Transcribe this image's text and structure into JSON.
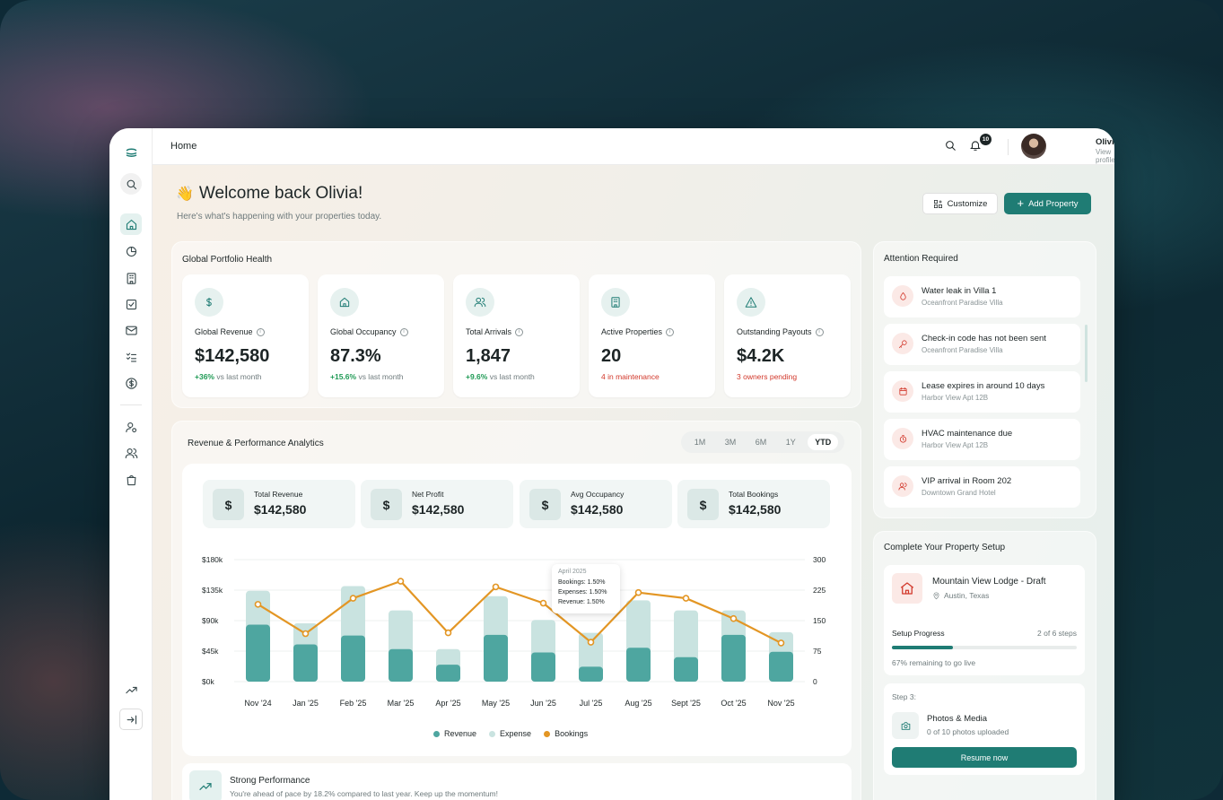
{
  "topbar": {
    "breadcrumb": "Home",
    "notification_count": "10",
    "user_name": "Olivia",
    "user_sub": "View profile"
  },
  "header": {
    "wave_emoji": "👋",
    "title": "Welcome back Olivia!",
    "subtitle": "Here's what's happening with your properties today.",
    "customize_label": "Customize",
    "add_property_label": "Add Property"
  },
  "portfolio": {
    "title": "Global Portfolio Health",
    "cards": [
      {
        "icon": "dollar-icon",
        "label": "Global Revenue",
        "value": "$142,580",
        "delta": "+36%",
        "note": " vs last month"
      },
      {
        "icon": "home-icon",
        "label": "Global Occupancy",
        "value": "87.3%",
        "delta": "+15.6%",
        "note": " vs last month"
      },
      {
        "icon": "users-icon",
        "label": "Total Arrivals",
        "value": "1,847",
        "delta": "+9.6%",
        "note": " vs last month"
      },
      {
        "icon": "building-icon",
        "label": "Active Properties",
        "value": "20",
        "alert": "4 in maintenance"
      },
      {
        "icon": "warning-icon",
        "label": "Outstanding Payouts",
        "value": "$4.2K",
        "alert": "3 owners pending"
      }
    ]
  },
  "analytics": {
    "title": "Revenue & Performance Analytics",
    "ranges": [
      "1M",
      "3M",
      "6M",
      "1Y",
      "YTD"
    ],
    "active_range": "YTD",
    "stats": [
      {
        "label": "Total Revenue",
        "value": "$142,580"
      },
      {
        "label": "Net Profit",
        "value": "$142,580"
      },
      {
        "label": "Avg Occupancy",
        "value": "$142,580"
      },
      {
        "label": "Total Bookings",
        "value": "$142,580"
      }
    ],
    "stat_icon_glyph": "$",
    "tooltip": {
      "title": "April 2025",
      "bookings": "Bookings: 1.50%",
      "expenses": "Expenses: 1.50%",
      "revenue": "Revenue: 1.50%"
    },
    "legend": {
      "revenue": "Revenue",
      "expense": "Expense",
      "bookings": "Bookings"
    }
  },
  "chart_data": {
    "type": "bar",
    "categories": [
      "Nov '24",
      "Jan '25",
      "Feb '25",
      "Mar '25",
      "Apr '25",
      "May '25",
      "Jun '25",
      "Jul '25",
      "Aug '25",
      "Sept '25",
      "Oct '25",
      "Nov '25"
    ],
    "left_axis": {
      "ticks": [
        "$0k",
        "$45k",
        "$90k",
        "$135k",
        "$180k"
      ],
      "range": [
        0,
        180
      ]
    },
    "right_axis": {
      "ticks": [
        "0",
        "75",
        "150",
        "225",
        "300"
      ],
      "range": [
        0,
        300
      ]
    },
    "series": [
      {
        "name": "Revenue",
        "type": "bar",
        "axis": "left",
        "color": "#4ea6a0",
        "values": [
          84,
          55,
          68,
          48,
          25,
          69,
          43,
          22,
          50,
          36,
          69,
          44
        ]
      },
      {
        "name": "Expense",
        "type": "bar",
        "axis": "left",
        "color": "#c9e3e0",
        "values": [
          134,
          86,
          141,
          105,
          48,
          126,
          91,
          72,
          120,
          105,
          105,
          73
        ]
      },
      {
        "name": "Bookings",
        "type": "line",
        "axis": "right",
        "color": "#e39624",
        "values": [
          190,
          118,
          205,
          247,
          120,
          233,
          193,
          97,
          219,
          205,
          155,
          95
        ]
      }
    ],
    "grid": true
  },
  "insight": {
    "title": "Strong Performance",
    "text": "You're ahead of pace by 18.2% compared to last year. Keep up the momentum!"
  },
  "attention": {
    "title": "Attention Required",
    "items": [
      {
        "icon": "drop-icon",
        "title": "Water leak in Villa 1",
        "sub": "Oceanfront Paradise Villa"
      },
      {
        "icon": "key-icon",
        "title": "Check-in code has not been sent",
        "sub": "Oceanfront Paradise Villa"
      },
      {
        "icon": "calendar-icon",
        "title": "Lease expires in around 10 days",
        "sub": "Harbor View Apt 12B"
      },
      {
        "icon": "timer-icon",
        "title": "HVAC maintenance due",
        "sub": "Harbor View Apt 12B"
      },
      {
        "icon": "users-icon",
        "title": "VIP arrival in Room 202",
        "sub": "Downtown Grand Hotel"
      }
    ]
  },
  "setup": {
    "title": "Complete Your Property Setup",
    "property_name": "Mountain View Lodge - Draft",
    "location": "Austin, Texas",
    "progress_label": "Setup Progress",
    "progress_steps": "2 of 6 steps",
    "progress_fraction": 0.33,
    "progress_note": "67% remaining to go live",
    "step_label": "Step 3:",
    "step_title": "Photos & Media",
    "step_sub": "0 of 10 photos uploaded",
    "resume_label": "Resume now"
  },
  "colors": {
    "accent": "#1f7c74",
    "alert": "#d2382b",
    "positive": "#1f9a55"
  }
}
